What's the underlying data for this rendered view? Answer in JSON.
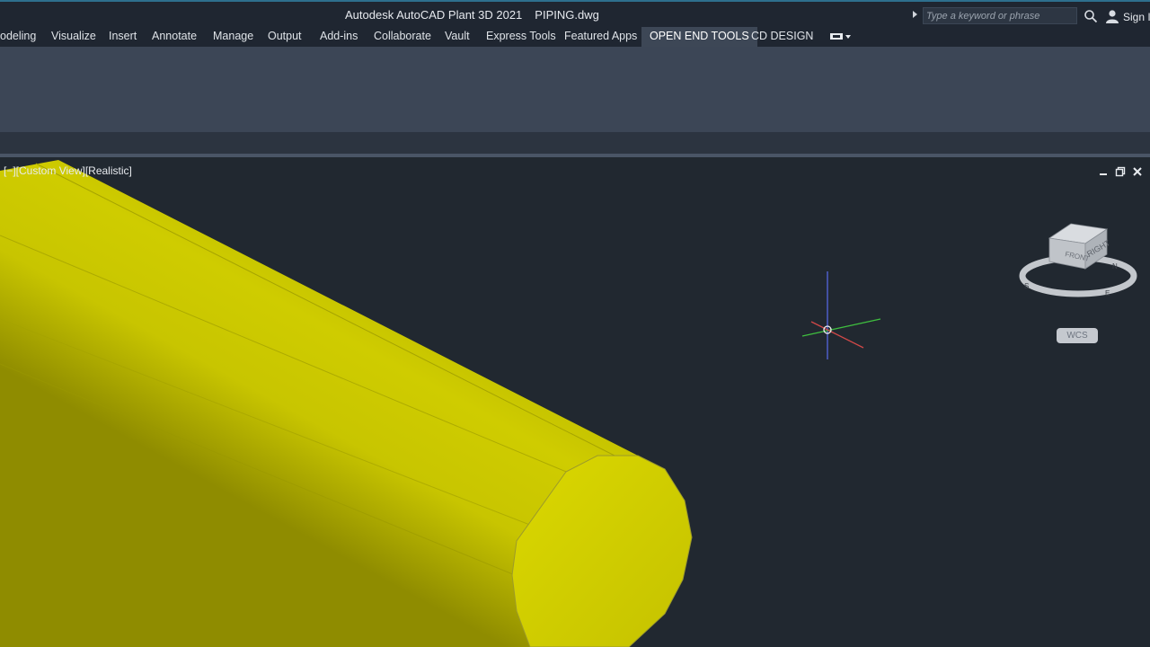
{
  "titlebar": {
    "app_name": "Autodesk AutoCAD Plant 3D 2021",
    "file_name": "PIPING.dwg",
    "search_placeholder": "Type a keyword or phrase",
    "sign_in": "Sign In"
  },
  "ribbon": {
    "tabs": [
      {
        "label": "odeling",
        "active": false
      },
      {
        "label": "Visualize",
        "active": false
      },
      {
        "label": "Insert",
        "active": false
      },
      {
        "label": "Annotate",
        "active": false
      },
      {
        "label": "Manage",
        "active": false
      },
      {
        "label": "Output",
        "active": false
      },
      {
        "label": "Add-ins",
        "active": false
      },
      {
        "label": "Collaborate",
        "active": false
      },
      {
        "label": "Vault",
        "active": false
      },
      {
        "label": "Express Tools",
        "active": false
      },
      {
        "label": "Featured Apps",
        "active": false
      },
      {
        "label": "OPEN END TOOLS",
        "active": true
      },
      {
        "label": "CD DESIGN",
        "active": false
      }
    ]
  },
  "viewport": {
    "label": "[−][Custom View][Realistic]",
    "object_color": "#c8c800",
    "viewcube": {
      "face_front": "FRONT",
      "face_right": "RIGHT",
      "compass": [
        "N",
        "E",
        "S"
      ],
      "wcs_label": "WCS"
    }
  },
  "colors": {
    "background": "#212830",
    "ribbon": "#3c4656",
    "active_tab": "#3d4756",
    "axis_x": "#d04848",
    "axis_y": "#3fbf3f",
    "axis_z": "#4a5bd6"
  }
}
